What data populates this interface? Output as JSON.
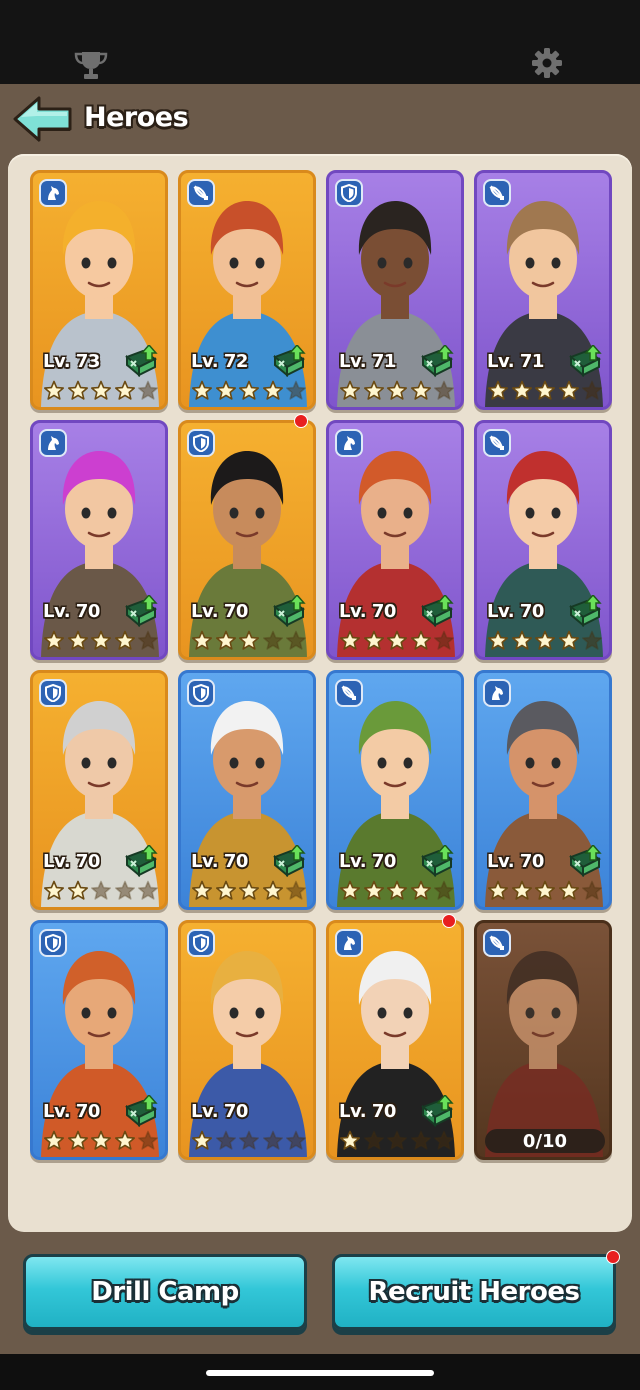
{
  "status_bar": {
    "left_icon": "trophy-icon",
    "right_icon": "gear-icon"
  },
  "header": {
    "title": "Heroes",
    "back_icon": "arrow-left-icon"
  },
  "heroes": [
    {
      "level_label": "Lv. 73",
      "stars": 4,
      "max_stars": 5,
      "class_icon": "horse-icon",
      "card_color": "#f0a62a",
      "upgrade_available": true,
      "new_badge": false
    },
    {
      "level_label": "Lv. 72",
      "stars": 4,
      "max_stars": 5,
      "class_icon": "crossbow-icon",
      "card_color": "#f0a62a",
      "upgrade_available": true,
      "new_badge": false
    },
    {
      "level_label": "Lv. 71",
      "stars": 4,
      "max_stars": 5,
      "class_icon": "shield-icon",
      "card_color": "#9a6fe0",
      "upgrade_available": true,
      "new_badge": false
    },
    {
      "level_label": "Lv. 71",
      "stars": 4,
      "max_stars": 5,
      "class_icon": "crossbow-icon",
      "card_color": "#9a6fe0",
      "upgrade_available": true,
      "new_badge": false
    },
    {
      "level_label": "Lv. 70",
      "stars": 4,
      "max_stars": 5,
      "class_icon": "horse-icon",
      "card_color": "#9a6fe0",
      "upgrade_available": true,
      "new_badge": false
    },
    {
      "level_label": "Lv. 70",
      "stars": 3,
      "max_stars": 5,
      "class_icon": "shield-icon",
      "card_color": "#f0a62a",
      "upgrade_available": true,
      "new_badge": true
    },
    {
      "level_label": "Lv. 70",
      "stars": 4,
      "max_stars": 5,
      "class_icon": "horse-icon",
      "card_color": "#9a6fe0",
      "upgrade_available": true,
      "new_badge": false
    },
    {
      "level_label": "Lv. 70",
      "stars": 4,
      "max_stars": 5,
      "class_icon": "crossbow-icon",
      "card_color": "#9a6fe0",
      "upgrade_available": true,
      "new_badge": false
    },
    {
      "level_label": "Lv. 70",
      "stars": 2,
      "max_stars": 5,
      "class_icon": "shield-icon",
      "card_color": "#f0a62a",
      "upgrade_available": true,
      "new_badge": false
    },
    {
      "level_label": "Lv. 70",
      "stars": 4,
      "max_stars": 5,
      "class_icon": "shield-icon",
      "card_color": "#4f98e8",
      "upgrade_available": true,
      "new_badge": false
    },
    {
      "level_label": "Lv. 70",
      "stars": 4,
      "max_stars": 5,
      "class_icon": "crossbow-icon",
      "card_color": "#4f98e8",
      "upgrade_available": true,
      "new_badge": false
    },
    {
      "level_label": "Lv. 70",
      "stars": 4,
      "max_stars": 5,
      "class_icon": "horse-icon",
      "card_color": "#4f98e8",
      "upgrade_available": true,
      "new_badge": false
    },
    {
      "level_label": "Lv. 70",
      "stars": 4,
      "max_stars": 5,
      "class_icon": "shield-icon",
      "card_color": "#4f98e8",
      "upgrade_available": true,
      "new_badge": false
    },
    {
      "level_label": "Lv. 70",
      "stars": 1,
      "max_stars": 5,
      "class_icon": "shield-icon",
      "card_color": "#f0a62a",
      "upgrade_available": false,
      "new_badge": false
    },
    {
      "level_label": "Lv. 70",
      "stars": 1,
      "max_stars": 5,
      "class_icon": "horse-icon",
      "card_color": "#f0a62a",
      "upgrade_available": true,
      "new_badge": true
    },
    {
      "locked": true,
      "shards_label": "0/10",
      "class_icon": "crossbow-icon",
      "card_color": "#6b4530"
    }
  ],
  "buttons": {
    "drill_camp": "Drill Camp",
    "recruit_heroes": "Recruit Heroes",
    "recruit_badge": true
  },
  "colors": {
    "background": "#6b5a4a",
    "panel": "#e9e0d0",
    "button_cyan": "#33c7d8",
    "star_filled": "#fff6cf",
    "star_empty": "#8a6a2a",
    "badge_red": "#e81f1f"
  }
}
